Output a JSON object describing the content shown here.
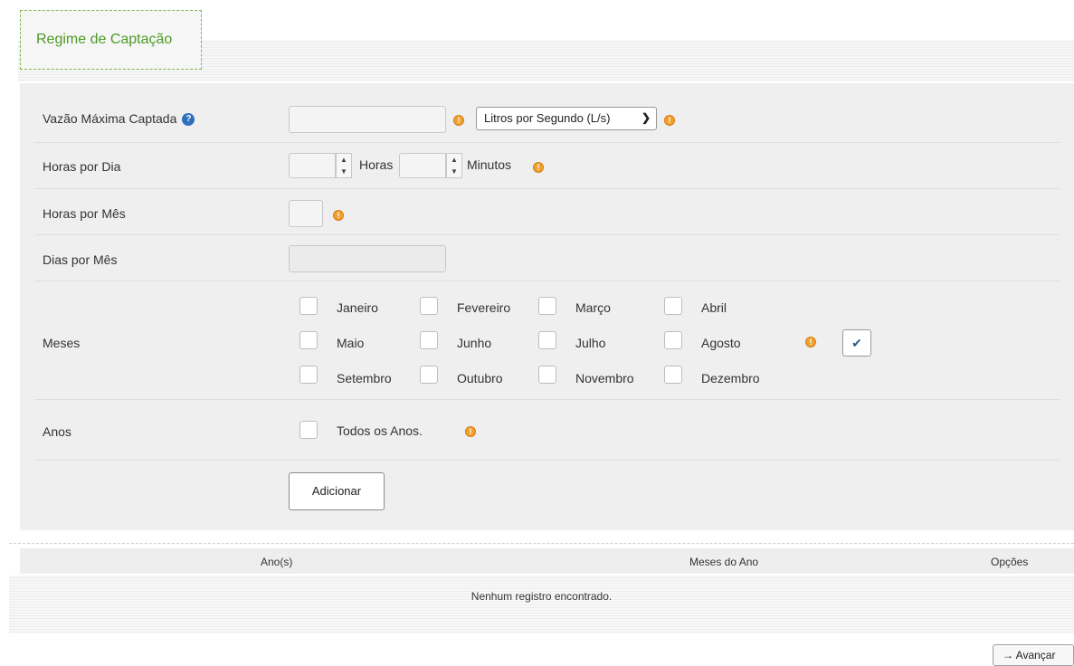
{
  "tab": {
    "title": "Regime de Captação"
  },
  "vazao": {
    "label": "Vazão Máxima Captada",
    "value": "",
    "unit_selected": "Litros por Segundo (L/s)"
  },
  "horas_dia": {
    "label": "Horas por Dia",
    "hours_value": "",
    "hours_text": "Horas",
    "minutes_value": "",
    "minutes_text": "Minutos"
  },
  "horas_mes": {
    "label": "Horas por Mês",
    "value": ""
  },
  "dias_mes": {
    "label": "Dias por Mês",
    "value": ""
  },
  "meses": {
    "label": "Meses",
    "items": [
      "Janeiro",
      "Fevereiro",
      "Março",
      "Abril",
      "Maio",
      "Junho",
      "Julho",
      "Agosto",
      "Setembro",
      "Outubro",
      "Novembro",
      "Dezembro"
    ]
  },
  "anos": {
    "label": "Anos",
    "todos_label": "Todos os Anos."
  },
  "actions": {
    "add_label": "Adicionar",
    "next_label": "Avançar"
  },
  "table": {
    "headers": [
      "Ano(s)",
      "Meses do Ano",
      "Opções"
    ],
    "empty_text": "Nenhum registro encontrado."
  },
  "icons": {
    "info": "question-icon",
    "warn": "exclamation-icon",
    "check": "check-icon",
    "arrow": "arrow-right-icon"
  }
}
